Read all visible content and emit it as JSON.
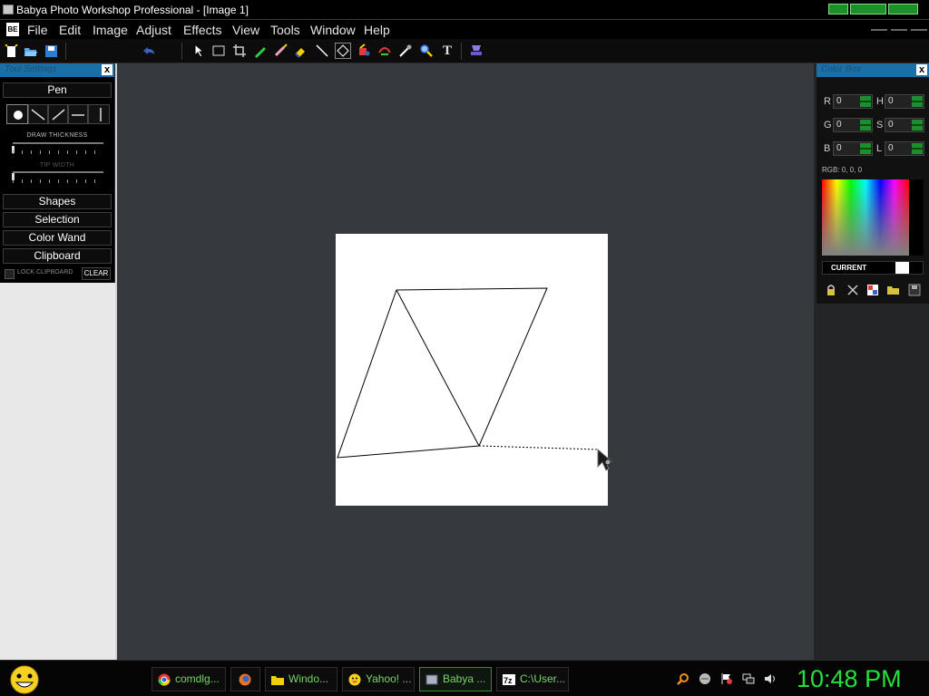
{
  "window": {
    "title": "Babya Photo Workshop Professional - [Image  1]"
  },
  "menu": [
    "File",
    "Edit",
    "Image",
    "Adjust",
    "Effects",
    "View",
    "Tools",
    "Window",
    "Help"
  ],
  "tool_settings": {
    "title": "Tool Settings",
    "close": "x",
    "pen_label": "Pen",
    "draw_thickness_label": "DRAW THICKNESS",
    "tip_width_label": "TIP WIDTH",
    "sections": [
      "Shapes",
      "Selection",
      "Color Wand",
      "Clipboard"
    ],
    "lock_clipboard_label": "LOCK CLIPBOARD",
    "clear_label": "CLEAR"
  },
  "color_box": {
    "title": "Color Box",
    "close": "x",
    "fields": [
      {
        "label": "R",
        "value": "0"
      },
      {
        "label": "H",
        "value": "0"
      },
      {
        "label": "G",
        "value": "0"
      },
      {
        "label": "S",
        "value": "0"
      },
      {
        "label": "B",
        "value": "0"
      },
      {
        "label": "L",
        "value": "0"
      }
    ],
    "rgb_text": "RGB: 0, 0, 0",
    "current_label": "CURRENT",
    "current_color": "#ffffff"
  },
  "taskbar": {
    "items": [
      {
        "label": "comdlg...",
        "icon": "chrome-icon"
      },
      {
        "label": "",
        "icon": "firefox-icon"
      },
      {
        "label": "Windo...",
        "icon": "folder-icon"
      },
      {
        "label": "Yahoo! ...",
        "icon": "yahoo-messenger-icon"
      },
      {
        "label": "Babya ...",
        "icon": "babya-icon"
      },
      {
        "label": "C:\\User...",
        "icon": "7zip-icon"
      }
    ],
    "clock": "10:48 PM"
  },
  "colors": {
    "accent": "#1a6fa6",
    "green": "#1d8e2c",
    "clock": "#25e03a",
    "task_text": "#7bd36a"
  }
}
